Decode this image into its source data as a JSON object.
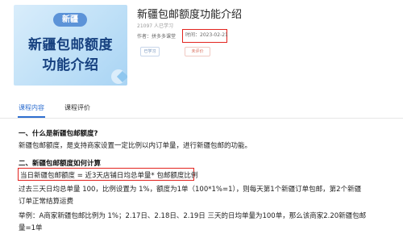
{
  "thumbnail": {
    "tag": "新疆",
    "title_line1": "新疆包邮额度",
    "title_line2": "功能介绍"
  },
  "course": {
    "title": "新疆包邮额度功能介绍",
    "learners": "21097 人已学习",
    "author": "作者：拼多多课堂",
    "time": "时间：2023-02-21",
    "badge_learned": "已学习",
    "badge_unrated": "未评价"
  },
  "tabs": [
    {
      "label": "课程内容"
    },
    {
      "label": "课程评价"
    }
  ],
  "content": {
    "section1_heading": "一、什么是新疆包邮额度?",
    "section1_text": "新疆包邮额度，是支持商家设置一定比例以内订单量，进行新疆包邮的功能。",
    "section2_heading": "二、新疆包邮额度如何计算",
    "formula": "当日新疆包邮额度 = 近3天店铺日均总单量* 包邮额度比例",
    "para2_line1": "过去三天日均总单量 100，比例设置为 1%，额度为1单（100*1%=1），则每天第1个新疆订单包邮，第2个新疆",
    "para2_line2": "订单正常结算运费",
    "para3_line1": "举例：A商家新疆包邮比例为 1%；2.17日、2.18日、2.19日 三天的日均单量为100单，那么该商家2.20新疆包邮",
    "para3_line2": "量=1单"
  },
  "colors": {
    "accent": "#2f6fd0",
    "highlight_border": "#e3241f"
  }
}
